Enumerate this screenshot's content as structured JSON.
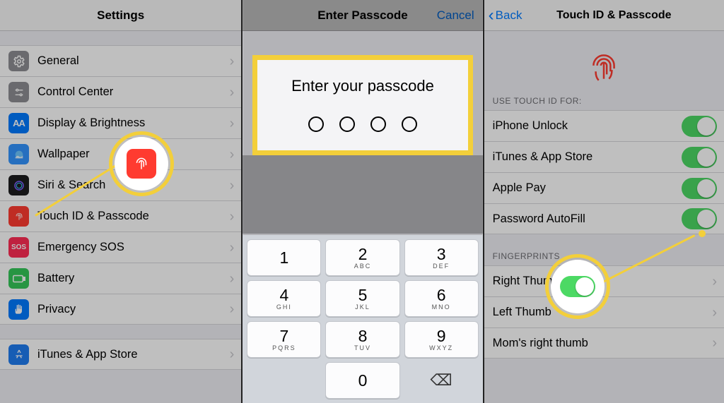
{
  "panel1": {
    "title": "Settings",
    "items": [
      {
        "label": "General"
      },
      {
        "label": "Control Center"
      },
      {
        "label": "Display & Brightness"
      },
      {
        "label": "Wallpaper"
      },
      {
        "label": "Siri & Search"
      },
      {
        "label": "Touch ID & Passcode"
      },
      {
        "label": "Emergency SOS"
      },
      {
        "label": "Battery"
      },
      {
        "label": "Privacy"
      }
    ],
    "appstore": {
      "label": "iTunes & App Store"
    }
  },
  "panel2": {
    "title": "Enter Passcode",
    "cancel": "Cancel",
    "prompt": "Enter your passcode",
    "keys": [
      {
        "n": "1",
        "l": ""
      },
      {
        "n": "2",
        "l": "ABC"
      },
      {
        "n": "3",
        "l": "DEF"
      },
      {
        "n": "4",
        "l": "GHI"
      },
      {
        "n": "5",
        "l": "JKL"
      },
      {
        "n": "6",
        "l": "MNO"
      },
      {
        "n": "7",
        "l": "PQRS"
      },
      {
        "n": "8",
        "l": "TUV"
      },
      {
        "n": "9",
        "l": "WXYZ"
      }
    ],
    "zero": "0",
    "backspace": "⌫"
  },
  "panel3": {
    "back": "Back",
    "title": "Touch ID & Passcode",
    "section1_header": "USE TOUCH ID FOR:",
    "toggles": [
      {
        "label": "iPhone Unlock"
      },
      {
        "label": "iTunes & App Store"
      },
      {
        "label": "Apple Pay"
      },
      {
        "label": "Password AutoFill"
      }
    ],
    "section2_header": "FINGERPRINTS",
    "fingerprints": [
      {
        "label": "Right Thumb"
      },
      {
        "label": "Left Thumb"
      },
      {
        "label": "Mom's right thumb"
      }
    ]
  }
}
